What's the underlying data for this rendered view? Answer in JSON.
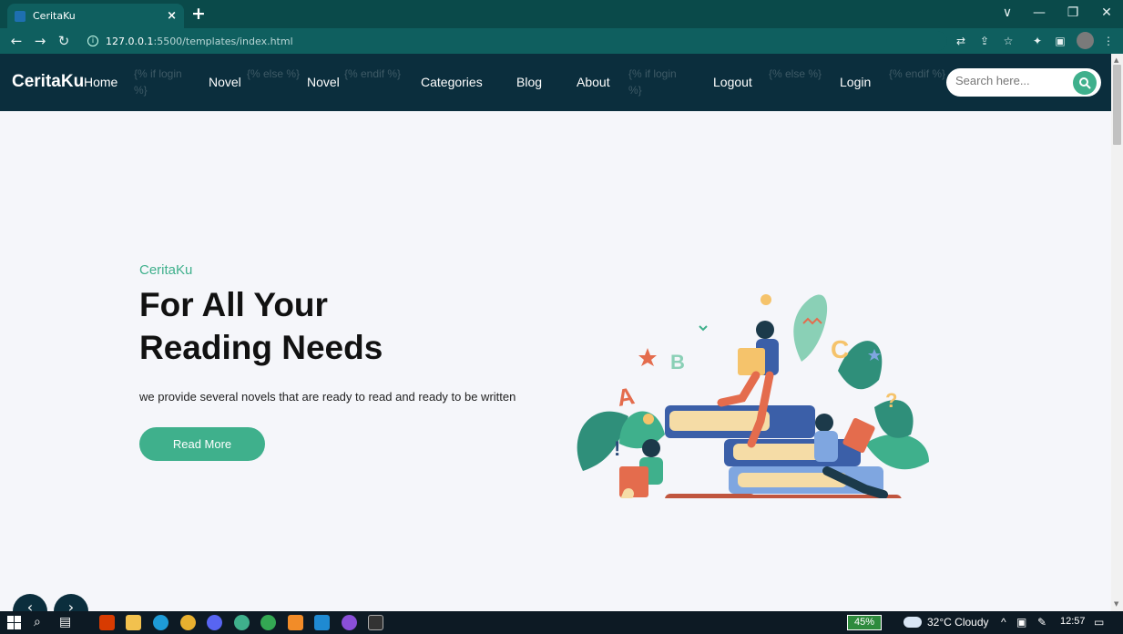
{
  "browser": {
    "tab_title": "CeritaKu",
    "tab_close": "×",
    "new_tab": "+",
    "url_host": "127.0.0.1",
    "url_path": ":5500/templates/index.html",
    "window_controls": [
      "∨",
      "—",
      "❐",
      "✕"
    ]
  },
  "navbar": {
    "brand": "CeritaKu",
    "links": [
      {
        "label": "Home"
      },
      {
        "label": "{% if login %}",
        "template": true
      },
      {
        "label": "Novel"
      },
      {
        "label": "{% else %}",
        "template": true
      },
      {
        "label": "Novel"
      },
      {
        "label": "{% endif %}",
        "template": true
      },
      {
        "label": "Categories"
      },
      {
        "label": "Blog"
      },
      {
        "label": "About"
      },
      {
        "label": "{% if login %}",
        "template": true
      },
      {
        "label": "Logout"
      },
      {
        "label": "{% else %}",
        "template": true
      },
      {
        "label": "Login"
      },
      {
        "label": "{% endif %}",
        "template": true
      }
    ],
    "search_placeholder": "Search here..."
  },
  "hero": {
    "eyebrow": "CeritaKu",
    "title_line1": "For All Your",
    "title_line2": "Reading Needs",
    "description": "we provide several novels that are ready to read and ready to be written",
    "button": "Read More"
  },
  "carousel": {
    "prev": "‹",
    "next": "›"
  },
  "taskbar": {
    "battery": "45%",
    "weather": "32°C  Cloudy",
    "time": "12:57"
  },
  "colors": {
    "accent": "#3fb08c",
    "navbar": "#0b2e3d",
    "page_bg": "#f5f6fa",
    "browser_frame": "#0f5f5f"
  }
}
